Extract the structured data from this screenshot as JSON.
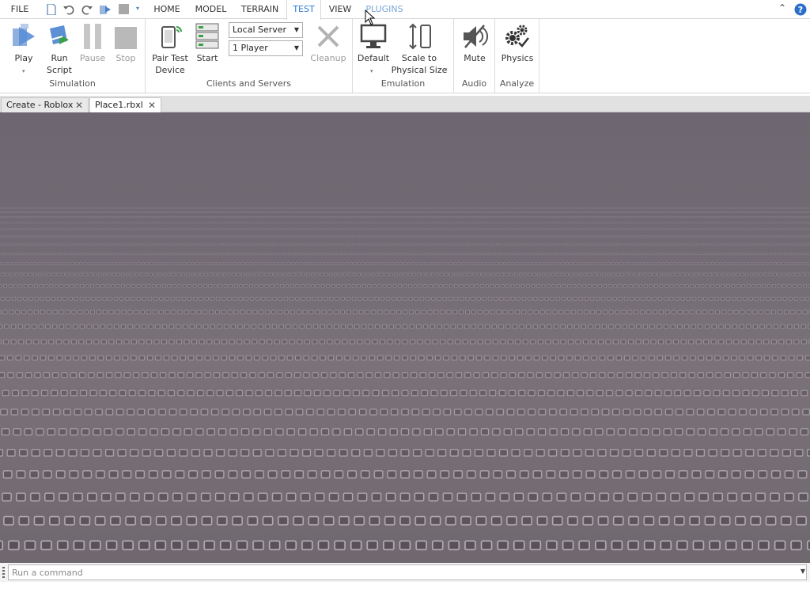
{
  "menubar": {
    "file": "FILE",
    "tabs": [
      "HOME",
      "MODEL",
      "TERRAIN",
      "TEST",
      "VIEW",
      "PLUGINS"
    ],
    "active_tab": "TEST"
  },
  "ribbon": {
    "simulation": {
      "label": "Simulation",
      "play": "Play",
      "run_script": "Run\nScript",
      "run_line1": "Run",
      "run_line2": "Script",
      "pause": "Pause",
      "stop": "Stop"
    },
    "clients_servers": {
      "label": "Clients and Servers",
      "pair_line1": "Pair Test",
      "pair_line2": "Device",
      "start": "Start",
      "server_mode": "Local Server",
      "players": "1 Player",
      "cleanup": "Cleanup"
    },
    "emulation": {
      "label": "Emulation",
      "default": "Default",
      "scale_line1": "Scale to",
      "scale_line2": "Physical Size"
    },
    "audio": {
      "label": "Audio",
      "mute": "Mute"
    },
    "analyze": {
      "label": "Analyze",
      "physics": "Physics"
    }
  },
  "doc_tabs": [
    "Create - Roblox",
    "Place1.rbxl"
  ],
  "command_bar": {
    "placeholder": "Run a command"
  },
  "colors": {
    "accent": "#2b7bd6",
    "viewport": "#716a72"
  }
}
